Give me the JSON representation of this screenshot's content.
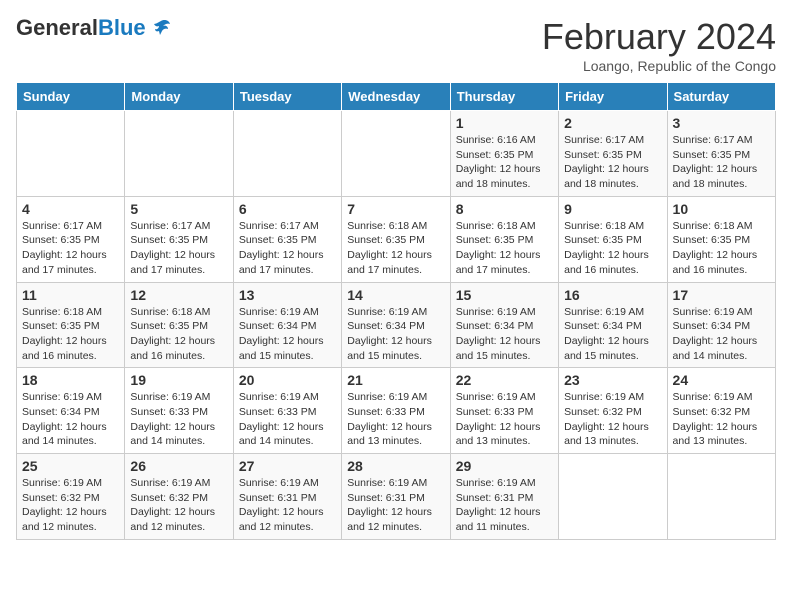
{
  "header": {
    "logo_general": "General",
    "logo_blue": "Blue",
    "title": "February 2024",
    "subtitle": "Loango, Republic of the Congo"
  },
  "days_of_week": [
    "Sunday",
    "Monday",
    "Tuesday",
    "Wednesday",
    "Thursday",
    "Friday",
    "Saturday"
  ],
  "weeks": [
    [
      {
        "day": "",
        "info": ""
      },
      {
        "day": "",
        "info": ""
      },
      {
        "day": "",
        "info": ""
      },
      {
        "day": "",
        "info": ""
      },
      {
        "day": "1",
        "info": "Sunrise: 6:16 AM\nSunset: 6:35 PM\nDaylight: 12 hours and 18 minutes."
      },
      {
        "day": "2",
        "info": "Sunrise: 6:17 AM\nSunset: 6:35 PM\nDaylight: 12 hours and 18 minutes."
      },
      {
        "day": "3",
        "info": "Sunrise: 6:17 AM\nSunset: 6:35 PM\nDaylight: 12 hours and 18 minutes."
      }
    ],
    [
      {
        "day": "4",
        "info": "Sunrise: 6:17 AM\nSunset: 6:35 PM\nDaylight: 12 hours and 17 minutes."
      },
      {
        "day": "5",
        "info": "Sunrise: 6:17 AM\nSunset: 6:35 PM\nDaylight: 12 hours and 17 minutes."
      },
      {
        "day": "6",
        "info": "Sunrise: 6:17 AM\nSunset: 6:35 PM\nDaylight: 12 hours and 17 minutes."
      },
      {
        "day": "7",
        "info": "Sunrise: 6:18 AM\nSunset: 6:35 PM\nDaylight: 12 hours and 17 minutes."
      },
      {
        "day": "8",
        "info": "Sunrise: 6:18 AM\nSunset: 6:35 PM\nDaylight: 12 hours and 17 minutes."
      },
      {
        "day": "9",
        "info": "Sunrise: 6:18 AM\nSunset: 6:35 PM\nDaylight: 12 hours and 16 minutes."
      },
      {
        "day": "10",
        "info": "Sunrise: 6:18 AM\nSunset: 6:35 PM\nDaylight: 12 hours and 16 minutes."
      }
    ],
    [
      {
        "day": "11",
        "info": "Sunrise: 6:18 AM\nSunset: 6:35 PM\nDaylight: 12 hours and 16 minutes."
      },
      {
        "day": "12",
        "info": "Sunrise: 6:18 AM\nSunset: 6:35 PM\nDaylight: 12 hours and 16 minutes."
      },
      {
        "day": "13",
        "info": "Sunrise: 6:19 AM\nSunset: 6:34 PM\nDaylight: 12 hours and 15 minutes."
      },
      {
        "day": "14",
        "info": "Sunrise: 6:19 AM\nSunset: 6:34 PM\nDaylight: 12 hours and 15 minutes."
      },
      {
        "day": "15",
        "info": "Sunrise: 6:19 AM\nSunset: 6:34 PM\nDaylight: 12 hours and 15 minutes."
      },
      {
        "day": "16",
        "info": "Sunrise: 6:19 AM\nSunset: 6:34 PM\nDaylight: 12 hours and 15 minutes."
      },
      {
        "day": "17",
        "info": "Sunrise: 6:19 AM\nSunset: 6:34 PM\nDaylight: 12 hours and 14 minutes."
      }
    ],
    [
      {
        "day": "18",
        "info": "Sunrise: 6:19 AM\nSunset: 6:34 PM\nDaylight: 12 hours and 14 minutes."
      },
      {
        "day": "19",
        "info": "Sunrise: 6:19 AM\nSunset: 6:33 PM\nDaylight: 12 hours and 14 minutes."
      },
      {
        "day": "20",
        "info": "Sunrise: 6:19 AM\nSunset: 6:33 PM\nDaylight: 12 hours and 14 minutes."
      },
      {
        "day": "21",
        "info": "Sunrise: 6:19 AM\nSunset: 6:33 PM\nDaylight: 12 hours and 13 minutes."
      },
      {
        "day": "22",
        "info": "Sunrise: 6:19 AM\nSunset: 6:33 PM\nDaylight: 12 hours and 13 minutes."
      },
      {
        "day": "23",
        "info": "Sunrise: 6:19 AM\nSunset: 6:32 PM\nDaylight: 12 hours and 13 minutes."
      },
      {
        "day": "24",
        "info": "Sunrise: 6:19 AM\nSunset: 6:32 PM\nDaylight: 12 hours and 13 minutes."
      }
    ],
    [
      {
        "day": "25",
        "info": "Sunrise: 6:19 AM\nSunset: 6:32 PM\nDaylight: 12 hours and 12 minutes."
      },
      {
        "day": "26",
        "info": "Sunrise: 6:19 AM\nSunset: 6:32 PM\nDaylight: 12 hours and 12 minutes."
      },
      {
        "day": "27",
        "info": "Sunrise: 6:19 AM\nSunset: 6:31 PM\nDaylight: 12 hours and 12 minutes."
      },
      {
        "day": "28",
        "info": "Sunrise: 6:19 AM\nSunset: 6:31 PM\nDaylight: 12 hours and 12 minutes."
      },
      {
        "day": "29",
        "info": "Sunrise: 6:19 AM\nSunset: 6:31 PM\nDaylight: 12 hours and 11 minutes."
      },
      {
        "day": "",
        "info": ""
      },
      {
        "day": "",
        "info": ""
      }
    ]
  ]
}
